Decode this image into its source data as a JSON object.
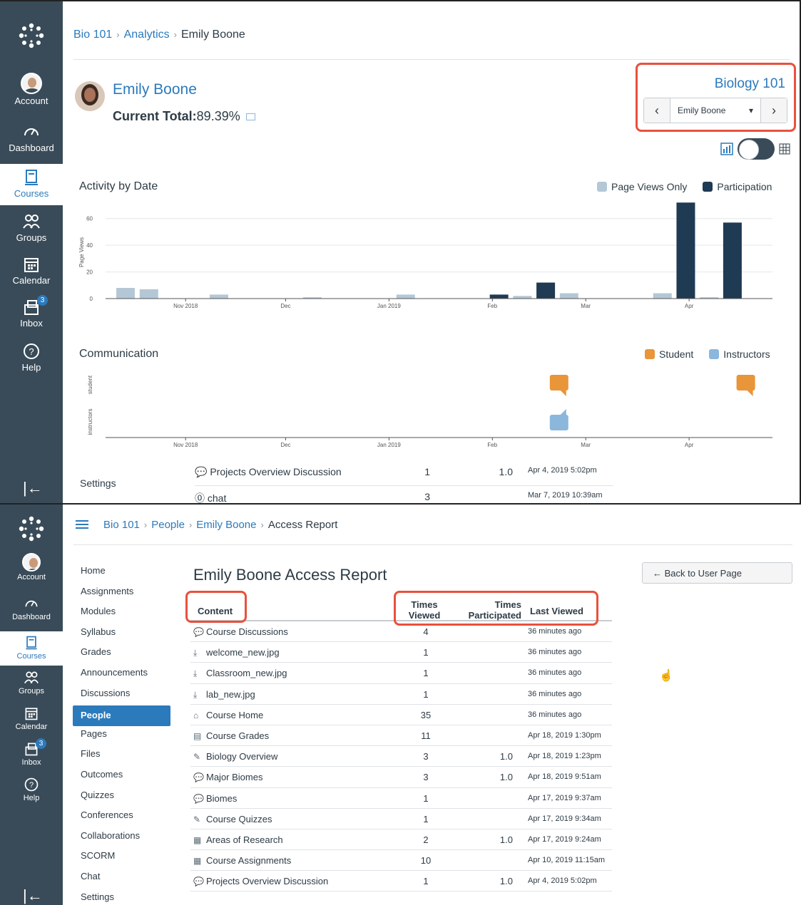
{
  "global_nav": {
    "items": [
      {
        "label": "Account",
        "icon": "account-avatar"
      },
      {
        "label": "Dashboard",
        "icon": "dashboard-icon"
      },
      {
        "label": "Courses",
        "icon": "courses-icon"
      },
      {
        "label": "Groups",
        "icon": "groups-icon"
      },
      {
        "label": "Calendar",
        "icon": "calendar-icon"
      },
      {
        "label": "Inbox",
        "icon": "inbox-icon",
        "badge": "3"
      },
      {
        "label": "Help",
        "icon": "help-icon"
      }
    ],
    "collapse_glyph": "|←"
  },
  "analytics": {
    "breadcrumb": [
      "Bio 101",
      "Analytics",
      "Emily Boone"
    ],
    "student_name": "Emily Boone",
    "current_total_label": "Current Total:",
    "current_total_value": "89.39%",
    "course_name": "Biology 101",
    "picker_value": "Emily Boone",
    "picker_prev": "‹",
    "picker_next": "›",
    "activity_title": "Activity by Date",
    "activity_legend": [
      "Page Views Only",
      "Participation"
    ],
    "communication_title": "Communication",
    "communication_legend": [
      "Student",
      "Instructors"
    ],
    "fragment_rows": [
      {
        "name": "Projects Overview Discussion",
        "viewed": "1",
        "participated": "1.0",
        "last": "Apr 4, 2019 5:02pm"
      },
      {
        "name": "chat",
        "viewed": "3",
        "participated": "",
        "last": "Mar 7, 2019 10:39am"
      }
    ],
    "settings_label": "Settings"
  },
  "chart_data": [
    {
      "type": "bar",
      "title": "Activity by Date",
      "ylabel": "Page Views",
      "ylim": [
        0,
        70
      ],
      "y_ticks": [
        "0",
        "20",
        "40",
        "60"
      ],
      "x_tick_labels": [
        "Nov 2018",
        "Dec",
        "Jan 2019",
        "Feb",
        "Mar",
        "Apr"
      ],
      "series": [
        {
          "name": "Page Views Only",
          "color": "#b4c7d6",
          "x": [
            "Oct 28",
            "Nov 4",
            "Nov 25",
            "Dec 23",
            "Jan 20",
            "Feb 24",
            "Mar 10",
            "Apr 7",
            "Apr 21"
          ],
          "values": [
            8,
            7,
            3,
            1,
            3,
            2,
            4,
            4,
            1
          ]
        },
        {
          "name": "Participation",
          "color": "#1f3a53",
          "x": [
            "Feb 17",
            "Mar 3",
            "Apr 14",
            "Apr 28"
          ],
          "values": [
            3,
            12,
            72,
            57
          ]
        }
      ]
    },
    {
      "type": "scatter",
      "title": "Communication",
      "y_categories": [
        "student",
        "instructors"
      ],
      "x_tick_labels": [
        "Nov 2018",
        "Dec",
        "Jan 2019",
        "Feb",
        "Mar",
        "Apr"
      ],
      "series": [
        {
          "name": "Student",
          "color": "#e9953a",
          "x": [
            "Mar 7",
            "May 2"
          ],
          "y": [
            "student",
            "student"
          ]
        },
        {
          "name": "Instructors",
          "color": "#8bb7dc",
          "x": [
            "Mar 7"
          ],
          "y": [
            "instructors"
          ]
        }
      ]
    }
  ],
  "access_report": {
    "breadcrumb": [
      "Bio 101",
      "People",
      "Emily Boone",
      "Access Report"
    ],
    "title": "Emily Boone Access Report",
    "back_button": "← Back to User Page",
    "course_nav": [
      "Home",
      "Assignments",
      "Modules",
      "Syllabus",
      "Grades",
      "Announcements",
      "Discussions",
      "People",
      "Pages",
      "Files",
      "Outcomes",
      "Quizzes",
      "Conferences",
      "Collaborations",
      "SCORM",
      "Chat",
      "Settings"
    ],
    "active_nav": "People",
    "columns": {
      "content": "Content",
      "times_viewed_1": "Times",
      "times_viewed_2": "Viewed",
      "times_participated_1": "Times",
      "times_participated_2": "Participated",
      "last_viewed": "Last Viewed"
    },
    "rows": [
      {
        "icon": "discussion-icon",
        "glyph": "💬",
        "name": "Course Discussions",
        "viewed": "4",
        "participated": "",
        "last": "36 minutes ago"
      },
      {
        "icon": "download-icon",
        "glyph": "⤓",
        "name": "welcome_new.jpg",
        "viewed": "1",
        "participated": "",
        "last": "36 minutes ago"
      },
      {
        "icon": "download-icon",
        "glyph": "⤓",
        "name": "Classroom_new.jpg",
        "viewed": "1",
        "participated": "",
        "last": "36 minutes ago"
      },
      {
        "icon": "download-icon",
        "glyph": "⤓",
        "name": "lab_new.jpg",
        "viewed": "1",
        "participated": "",
        "last": "36 minutes ago"
      },
      {
        "icon": "home-icon",
        "glyph": "⌂",
        "name": "Course Home",
        "viewed": "35",
        "participated": "",
        "last": "36 minutes ago"
      },
      {
        "icon": "gradebook-icon",
        "glyph": "▤",
        "name": "Course Grades",
        "viewed": "11",
        "participated": "",
        "last": "Apr 18, 2019 1:30pm"
      },
      {
        "icon": "quiz-icon",
        "glyph": "✎",
        "name": "Biology Overview",
        "viewed": "3",
        "participated": "1.0",
        "last": "Apr 18, 2019 1:23pm"
      },
      {
        "icon": "discussion-icon",
        "glyph": "💬",
        "name": "Major Biomes",
        "viewed": "3",
        "participated": "1.0",
        "last": "Apr 18, 2019 9:51am"
      },
      {
        "icon": "discussion-icon",
        "glyph": "💬",
        "name": "Biomes",
        "viewed": "1",
        "participated": "",
        "last": "Apr 17, 2019 9:37am"
      },
      {
        "icon": "quiz-icon",
        "glyph": "✎",
        "name": "Course Quizzes",
        "viewed": "1",
        "participated": "",
        "last": "Apr 17, 2019 9:34am"
      },
      {
        "icon": "assignment-icon",
        "glyph": "▦",
        "name": "Areas of Research",
        "viewed": "2",
        "participated": "1.0",
        "last": "Apr 17, 2019 9:24am"
      },
      {
        "icon": "assignment-icon",
        "glyph": "▦",
        "name": "Course Assignments",
        "viewed": "10",
        "participated": "",
        "last": "Apr 10, 2019 11:15am"
      },
      {
        "icon": "discussion-icon",
        "glyph": "💬",
        "name": "Projects Overview Discussion",
        "viewed": "1",
        "participated": "1.0",
        "last": "Apr 4, 2019 5:02pm"
      }
    ]
  },
  "colors": {
    "nav_bg": "#394b58",
    "link": "#2b7abc",
    "highlight": "#e8513d",
    "page_views": "#b4c7d6",
    "participation": "#1f3a53",
    "student": "#e9953a",
    "instructors": "#8bb7dc"
  }
}
